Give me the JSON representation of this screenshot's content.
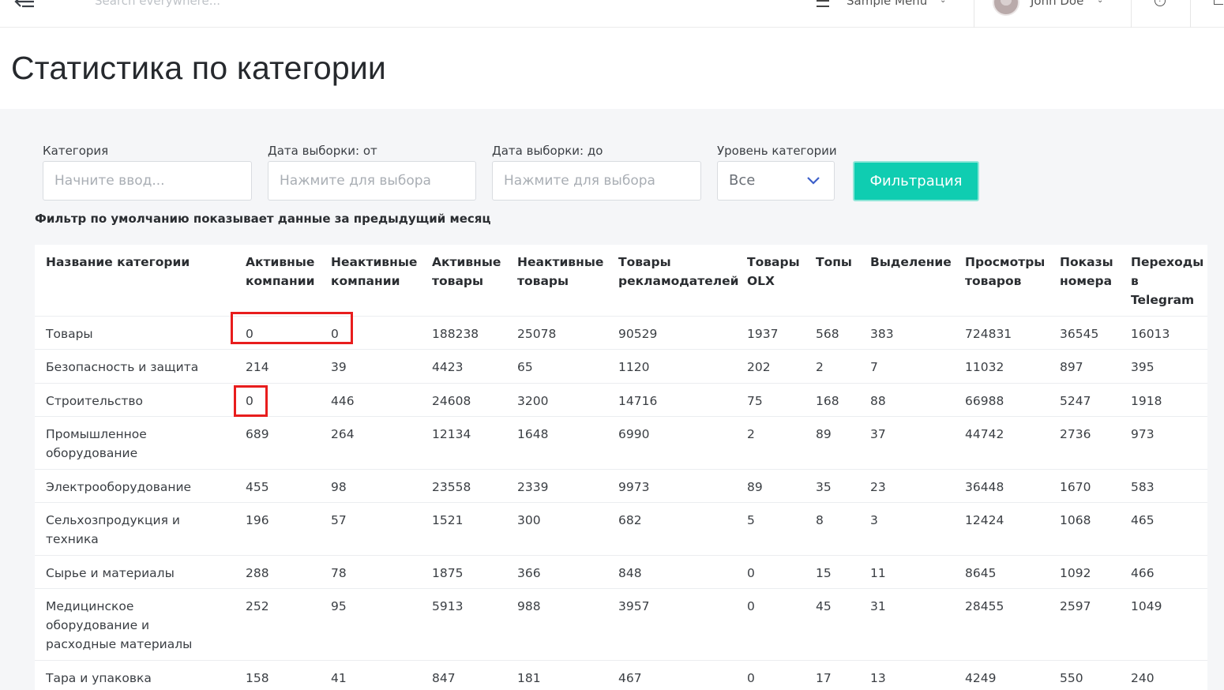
{
  "topbar": {
    "search_placeholder": "Search everywhere...",
    "menu_label": "Sample Menu",
    "user_name": "John Doe",
    "icons": [
      "back-arrow-icon",
      "menu-icon",
      "chevron-down-icon",
      "avatar",
      "help-icon",
      "logout-icon"
    ]
  },
  "page": {
    "title": "Статистика по категории"
  },
  "filters": {
    "category_label": "Категория",
    "category_placeholder": "Начните ввод...",
    "date_from_label": "Дата выборки: от",
    "date_from_placeholder": "Нажмите для выбора",
    "date_to_label": "Дата выборки: до",
    "date_to_placeholder": "Нажмите для выбора",
    "level_label": "Уровень категории",
    "level_value": "Все",
    "button_label": "Фильтрация",
    "button_color": "#0fcdb1",
    "note": "Фильтр по умолчанию показывает данные за предыдущий месяц"
  },
  "table": {
    "headers": [
      [
        "Название категории"
      ],
      [
        "Активные",
        "компании"
      ],
      [
        "Неактивные",
        "компании"
      ],
      [
        "Активные",
        "товары"
      ],
      [
        "Неактивные",
        "товары"
      ],
      [
        "Товары",
        "рекламодателей"
      ],
      [
        "Товары",
        "OLX"
      ],
      [
        "Топы"
      ],
      [
        "Выделение"
      ],
      [
        "Просмотры",
        "товаров"
      ],
      [
        "Показы",
        "номера"
      ],
      [
        "Переходы",
        "в",
        "Telegram"
      ]
    ],
    "rows": [
      [
        [
          "Товары"
        ],
        "0",
        "0",
        "188238",
        "25078",
        "90529",
        "1937",
        "568",
        "383",
        "724831",
        "36545",
        "16013"
      ],
      [
        [
          "Безопасность и защита"
        ],
        "214",
        "39",
        "4423",
        "65",
        "1120",
        "202",
        "2",
        "7",
        "11032",
        "897",
        "395"
      ],
      [
        [
          "Строительство"
        ],
        "0",
        "446",
        "24608",
        "3200",
        "14716",
        "75",
        "168",
        "88",
        "66988",
        "5247",
        "1918"
      ],
      [
        [
          "Промышленное",
          "оборудование"
        ],
        "689",
        "264",
        "12134",
        "1648",
        "6990",
        "2",
        "89",
        "37",
        "44742",
        "2736",
        "973"
      ],
      [
        [
          "Электрооборудование"
        ],
        "455",
        "98",
        "23558",
        "2339",
        "9973",
        "89",
        "35",
        "23",
        "36448",
        "1670",
        "583"
      ],
      [
        [
          "Сельхозпродукция и",
          "техника"
        ],
        "196",
        "57",
        "1521",
        "300",
        "682",
        "5",
        "8",
        "3",
        "12424",
        "1068",
        "465"
      ],
      [
        [
          "Сырье и материалы"
        ],
        "288",
        "78",
        "1875",
        "366",
        "848",
        "0",
        "15",
        "11",
        "8645",
        "1092",
        "466"
      ],
      [
        [
          "Медицинское",
          "оборудование и",
          "расходные материалы"
        ],
        "252",
        "95",
        "5913",
        "988",
        "3957",
        "0",
        "45",
        "31",
        "28455",
        "2597",
        "1049"
      ],
      [
        [
          "Тара и упаковка"
        ],
        "158",
        "41",
        "847",
        "181",
        "467",
        "0",
        "17",
        "13",
        "4249",
        "550",
        "240"
      ]
    ],
    "highlight_color": "#e81d1d"
  }
}
